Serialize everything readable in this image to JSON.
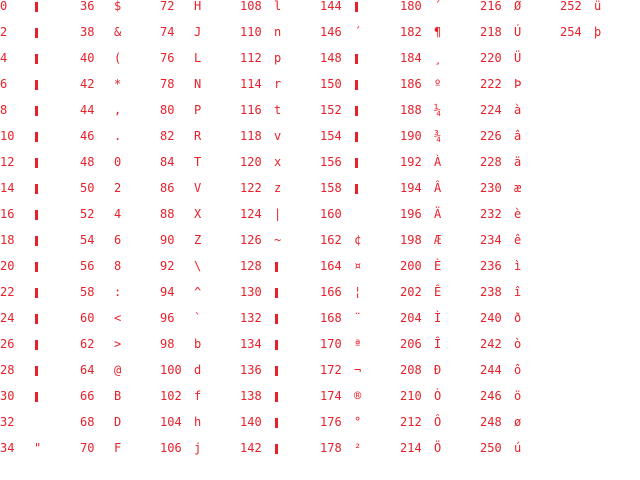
{
  "window": {
    "title": "Character code table"
  },
  "theme": {
    "text_color": "#e8202a",
    "background": "#ffffff"
  },
  "columns": [
    [
      {
        "code": "0",
        "glyph": "block"
      },
      {
        "code": "2",
        "glyph": "block"
      },
      {
        "code": "4",
        "glyph": "block"
      },
      {
        "code": "6",
        "glyph": "block"
      },
      {
        "code": "8",
        "glyph": "block"
      },
      {
        "code": "10",
        "glyph": "block"
      },
      {
        "code": "12",
        "glyph": "block"
      },
      {
        "code": "14",
        "glyph": "block"
      },
      {
        "code": "16",
        "glyph": "block"
      },
      {
        "code": "18",
        "glyph": "block"
      },
      {
        "code": "20",
        "glyph": "block"
      },
      {
        "code": "22",
        "glyph": "block"
      },
      {
        "code": "24",
        "glyph": "block"
      },
      {
        "code": "26",
        "glyph": "block"
      },
      {
        "code": "28",
        "glyph": "block"
      },
      {
        "code": "30",
        "glyph": "block"
      },
      {
        "code": "32",
        "glyph": ""
      },
      {
        "code": "34",
        "glyph": "\""
      }
    ],
    [
      {
        "code": "36",
        "glyph": "$"
      },
      {
        "code": "38",
        "glyph": "&"
      },
      {
        "code": "40",
        "glyph": "("
      },
      {
        "code": "42",
        "glyph": "*"
      },
      {
        "code": "44",
        "glyph": ","
      },
      {
        "code": "46",
        "glyph": "."
      },
      {
        "code": "48",
        "glyph": "0"
      },
      {
        "code": "50",
        "glyph": "2"
      },
      {
        "code": "52",
        "glyph": "4"
      },
      {
        "code": "54",
        "glyph": "6"
      },
      {
        "code": "56",
        "glyph": "8"
      },
      {
        "code": "58",
        "glyph": ":"
      },
      {
        "code": "60",
        "glyph": "<"
      },
      {
        "code": "62",
        "glyph": ">"
      },
      {
        "code": "64",
        "glyph": "@"
      },
      {
        "code": "66",
        "glyph": "B"
      },
      {
        "code": "68",
        "glyph": "D"
      },
      {
        "code": "70",
        "glyph": "F"
      }
    ],
    [
      {
        "code": "72",
        "glyph": "H"
      },
      {
        "code": "74",
        "glyph": "J"
      },
      {
        "code": "76",
        "glyph": "L"
      },
      {
        "code": "78",
        "glyph": "N"
      },
      {
        "code": "80",
        "glyph": "P"
      },
      {
        "code": "82",
        "glyph": "R"
      },
      {
        "code": "84",
        "glyph": "T"
      },
      {
        "code": "86",
        "glyph": "V"
      },
      {
        "code": "88",
        "glyph": "X"
      },
      {
        "code": "90",
        "glyph": "Z"
      },
      {
        "code": "92",
        "glyph": "\\"
      },
      {
        "code": "94",
        "glyph": "^"
      },
      {
        "code": "96",
        "glyph": "`"
      },
      {
        "code": "98",
        "glyph": "b"
      },
      {
        "code": "100",
        "glyph": "d"
      },
      {
        "code": "102",
        "glyph": "f"
      },
      {
        "code": "104",
        "glyph": "h"
      },
      {
        "code": "106",
        "glyph": "j"
      }
    ],
    [
      {
        "code": "108",
        "glyph": "l"
      },
      {
        "code": "110",
        "glyph": "n"
      },
      {
        "code": "112",
        "glyph": "p"
      },
      {
        "code": "114",
        "glyph": "r"
      },
      {
        "code": "116",
        "glyph": "t"
      },
      {
        "code": "118",
        "glyph": "v"
      },
      {
        "code": "120",
        "glyph": "x"
      },
      {
        "code": "122",
        "glyph": "z"
      },
      {
        "code": "124",
        "glyph": "|"
      },
      {
        "code": "126",
        "glyph": "~"
      },
      {
        "code": "128",
        "glyph": "block"
      },
      {
        "code": "130",
        "glyph": "block"
      },
      {
        "code": "132",
        "glyph": "block"
      },
      {
        "code": "134",
        "glyph": "block"
      },
      {
        "code": "136",
        "glyph": "block"
      },
      {
        "code": "138",
        "glyph": "block"
      },
      {
        "code": "140",
        "glyph": "block"
      },
      {
        "code": "142",
        "glyph": "block"
      }
    ],
    [
      {
        "code": "144",
        "glyph": "block"
      },
      {
        "code": "146",
        "glyph": "´"
      },
      {
        "code": "148",
        "glyph": "block"
      },
      {
        "code": "150",
        "glyph": "block"
      },
      {
        "code": "152",
        "glyph": "block"
      },
      {
        "code": "154",
        "glyph": "block"
      },
      {
        "code": "156",
        "glyph": "block"
      },
      {
        "code": "158",
        "glyph": "block"
      },
      {
        "code": "160",
        "glyph": ""
      },
      {
        "code": "162",
        "glyph": "¢"
      },
      {
        "code": "164",
        "glyph": "¤"
      },
      {
        "code": "166",
        "glyph": "¦"
      },
      {
        "code": "168",
        "glyph": "¨"
      },
      {
        "code": "170",
        "glyph": "ª"
      },
      {
        "code": "172",
        "glyph": "¬"
      },
      {
        "code": "174",
        "glyph": "®"
      },
      {
        "code": "176",
        "glyph": "°"
      },
      {
        "code": "178",
        "glyph": "²"
      }
    ],
    [
      {
        "code": "180",
        "glyph": "´"
      },
      {
        "code": "182",
        "glyph": "¶"
      },
      {
        "code": "184",
        "glyph": "¸"
      },
      {
        "code": "186",
        "glyph": "º"
      },
      {
        "code": "188",
        "glyph": "¼"
      },
      {
        "code": "190",
        "glyph": "¾"
      },
      {
        "code": "192",
        "glyph": "À"
      },
      {
        "code": "194",
        "glyph": "Â"
      },
      {
        "code": "196",
        "glyph": "Ä"
      },
      {
        "code": "198",
        "glyph": "Æ"
      },
      {
        "code": "200",
        "glyph": "È"
      },
      {
        "code": "202",
        "glyph": "Ê"
      },
      {
        "code": "204",
        "glyph": "Ì"
      },
      {
        "code": "206",
        "glyph": "Î"
      },
      {
        "code": "208",
        "glyph": "Ð"
      },
      {
        "code": "210",
        "glyph": "Ò"
      },
      {
        "code": "212",
        "glyph": "Ô"
      },
      {
        "code": "214",
        "glyph": "Ö"
      }
    ],
    [
      {
        "code": "216",
        "glyph": "Ø"
      },
      {
        "code": "218",
        "glyph": "Ú"
      },
      {
        "code": "220",
        "glyph": "Ü"
      },
      {
        "code": "222",
        "glyph": "Þ"
      },
      {
        "code": "224",
        "glyph": "à"
      },
      {
        "code": "226",
        "glyph": "â"
      },
      {
        "code": "228",
        "glyph": "ä"
      },
      {
        "code": "230",
        "glyph": "æ"
      },
      {
        "code": "232",
        "glyph": "è"
      },
      {
        "code": "234",
        "glyph": "ê"
      },
      {
        "code": "236",
        "glyph": "ì"
      },
      {
        "code": "238",
        "glyph": "î"
      },
      {
        "code": "240",
        "glyph": "ð"
      },
      {
        "code": "242",
        "glyph": "ò"
      },
      {
        "code": "244",
        "glyph": "ô"
      },
      {
        "code": "246",
        "glyph": "ö"
      },
      {
        "code": "248",
        "glyph": "ø"
      },
      {
        "code": "250",
        "glyph": "ú"
      }
    ],
    [
      {
        "code": "252",
        "glyph": "ü"
      },
      {
        "code": "254",
        "glyph": "þ"
      }
    ]
  ]
}
